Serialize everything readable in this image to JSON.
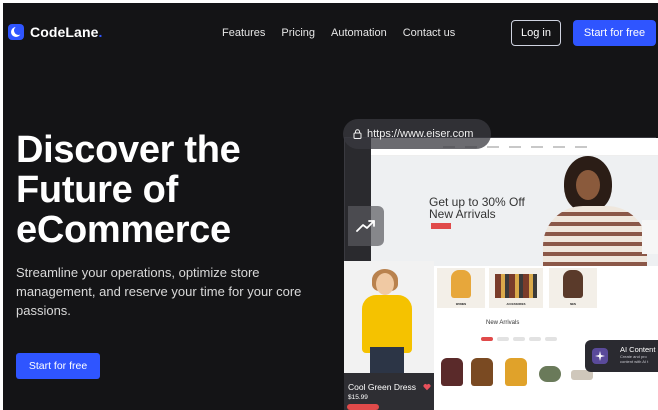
{
  "brand": {
    "name": "CodeLane",
    "dot": ".",
    "accent": "#2f55ff"
  },
  "nav": {
    "items": [
      "Features",
      "Pricing",
      "Automation",
      "Contact us"
    ]
  },
  "header_actions": {
    "login": "Log in",
    "start": "Start for free"
  },
  "hero": {
    "title": "Discover the Future of eCommerce",
    "subtitle": "Streamline your operations, optimize store management, and reserve your time for your core passions.",
    "cta": "Start for free"
  },
  "mockup": {
    "url": "https://www.eiser.com",
    "banner_headline": "Get up to 30% Off New Arrivals",
    "categories": [
      "WOMEN",
      "ACCESSORIES",
      "MEN"
    ],
    "section_title": "New Arrivals",
    "product_card": {
      "name": "Cool Green Dress",
      "price": "$15.99"
    },
    "ai_card": {
      "title": "AI Content",
      "subtitle": "Create and pro content with AI t"
    }
  }
}
